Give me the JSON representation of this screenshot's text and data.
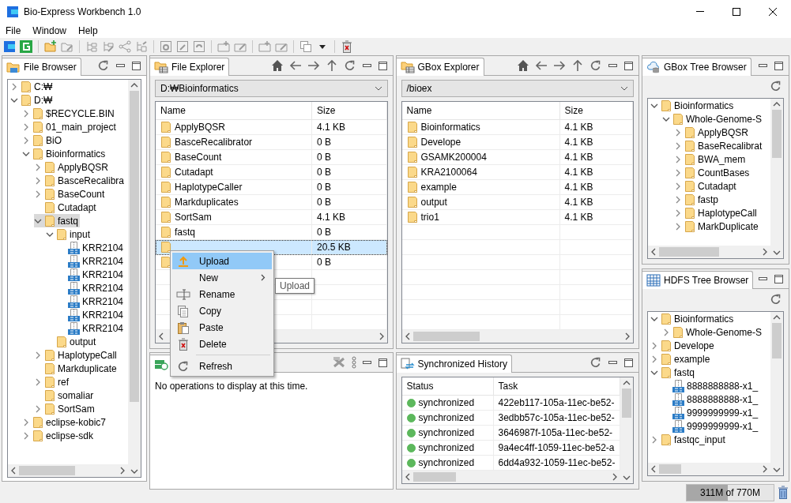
{
  "window": {
    "title": "Bio-Express Workbench 1.0"
  },
  "menu": [
    "File",
    "Window",
    "Help"
  ],
  "file_browser": {
    "title": "File Browser",
    "tree": [
      {
        "label": "C:₩",
        "kind": "folder",
        "expanded": false,
        "selected": false
      },
      {
        "label": "D:₩",
        "kind": "folder",
        "expanded": true,
        "selected": false,
        "children": [
          {
            "label": "$RECYCLE.BIN",
            "kind": "folder",
            "expanded": false,
            "selected": false
          },
          {
            "label": "01_main_project",
            "kind": "folder",
            "expanded": false,
            "selected": false
          },
          {
            "label": "BiO",
            "kind": "folder",
            "expanded": false,
            "selected": false
          },
          {
            "label": "Bioinformatics",
            "kind": "folder",
            "expanded": true,
            "selected": false,
            "children": [
              {
                "label": "ApplyBQSR",
                "kind": "folder",
                "expanded": false,
                "selected": false
              },
              {
                "label": "BasceRecalibra",
                "kind": "folder",
                "expanded": false,
                "selected": false
              },
              {
                "label": "BaseCount",
                "kind": "folder",
                "expanded": false,
                "selected": false
              },
              {
                "label": "Cutadapt",
                "kind": "folder",
                "selected": false
              },
              {
                "label": "fastq",
                "kind": "folder",
                "expanded": true,
                "selected": true,
                "children": [
                  {
                    "label": "input",
                    "kind": "folder",
                    "expanded": true,
                    "selected": false,
                    "children": [
                      {
                        "label": "KRR2104",
                        "kind": "archive",
                        "selected": false
                      },
                      {
                        "label": "KRR2104",
                        "kind": "archive",
                        "selected": false
                      },
                      {
                        "label": "KRR2104",
                        "kind": "archive",
                        "selected": false
                      },
                      {
                        "label": "KRR2104",
                        "kind": "archive",
                        "selected": false
                      },
                      {
                        "label": "KRR2104",
                        "kind": "archive",
                        "selected": false
                      },
                      {
                        "label": "KRR2104",
                        "kind": "archive",
                        "selected": false
                      },
                      {
                        "label": "KRR2104",
                        "kind": "archive",
                        "selected": false
                      }
                    ]
                  },
                  {
                    "label": "output",
                    "kind": "folder",
                    "selected": false
                  }
                ]
              },
              {
                "label": "HaplotypeCall",
                "kind": "folder",
                "expanded": false,
                "selected": false
              },
              {
                "label": "Markduplicate",
                "kind": "folder",
                "selected": false
              },
              {
                "label": "ref",
                "kind": "folder",
                "expanded": false,
                "selected": false
              },
              {
                "label": "somaliar",
                "kind": "folder",
                "selected": false
              },
              {
                "label": "SortSam",
                "kind": "folder",
                "expanded": false,
                "selected": false
              }
            ]
          },
          {
            "label": "eclipse-kobic7",
            "kind": "folder",
            "expanded": false,
            "selected": false
          },
          {
            "label": "eclipse-sdk",
            "kind": "folder",
            "expanded": false,
            "selected": false
          }
        ]
      }
    ]
  },
  "file_explorer": {
    "title": "File Explorer",
    "path": "D:₩Bioinformatics",
    "columns": [
      "Name",
      "Size"
    ],
    "rows": [
      {
        "name": "ApplyBQSR",
        "size": "4.1 KB",
        "selected": false
      },
      {
        "name": "BasceRecalibrator",
        "size": "0 B",
        "selected": false
      },
      {
        "name": "BaseCount",
        "size": "0 B",
        "selected": false
      },
      {
        "name": "Cutadapt",
        "size": "0 B",
        "selected": false
      },
      {
        "name": "HaplotypeCaller",
        "size": "0 B",
        "selected": false
      },
      {
        "name": "Markduplicates",
        "size": "0 B",
        "selected": false
      },
      {
        "name": "SortSam",
        "size": "4.1 KB",
        "selected": false
      },
      {
        "name": "fastq",
        "size": "0 B",
        "selected": false
      },
      {
        "size": "20.5 KB",
        "selected": true
      },
      {
        "size": "0 B",
        "selected": false
      }
    ]
  },
  "gbox_explorer": {
    "title": "GBox Explorer",
    "path": "/bioex",
    "columns": [
      "Name",
      "Size"
    ],
    "rows": [
      {
        "name": "Bioinformatics",
        "size": "4.1 KB",
        "selected": false
      },
      {
        "name": "Develope",
        "size": "4.1 KB",
        "selected": false
      },
      {
        "name": "GSAMK200004",
        "size": "4.1 KB",
        "selected": false
      },
      {
        "name": "KRA2100064",
        "size": "4.1 KB",
        "selected": false
      },
      {
        "name": "example",
        "size": "4.1 KB",
        "selected": false
      },
      {
        "name": "output",
        "size": "4.1 KB",
        "selected": false
      },
      {
        "name": "trio1",
        "size": "4.1 KB",
        "selected": false
      }
    ]
  },
  "context_menu": {
    "items": [
      {
        "kind": "item",
        "label": "Upload",
        "selected": true
      },
      {
        "kind": "submenu",
        "label": "New",
        "selected": false
      },
      {
        "kind": "item",
        "label": "Rename",
        "selected": false
      },
      {
        "kind": "item",
        "label": "Copy",
        "selected": false
      },
      {
        "kind": "item",
        "label": "Paste",
        "selected": false
      },
      {
        "kind": "item",
        "label": "Delete",
        "selected": false
      },
      {
        "kind": "separator"
      },
      {
        "kind": "item",
        "label": "Refresh",
        "selected": false
      }
    ],
    "tooltip": "Upload"
  },
  "operations": {
    "message": "No operations to display at this time."
  },
  "sync_history": {
    "title": "Synchronized History",
    "columns": [
      "Status",
      "Task"
    ],
    "rows": [
      {
        "status": "synchronized",
        "task": "422eb117-105a-11ec-be52-",
        "color": "#5cb85c"
      },
      {
        "status": "synchronized",
        "task": "3edbb57c-105a-11ec-be52-",
        "color": "#5cb85c"
      },
      {
        "status": "synchronized",
        "task": "3646987f-105a-11ec-be52-",
        "color": "#5cb85c"
      },
      {
        "status": "synchronized",
        "task": "9a4ec4ff-1059-11ec-be52-a",
        "color": "#5cb85c"
      },
      {
        "status": "synchronized",
        "task": "6dd4a932-1059-11ec-be52-",
        "color": "#5cb85c"
      }
    ]
  },
  "gbox_tree": {
    "title": "GBox Tree Browser",
    "tree": [
      {
        "label": "Bioinformatics",
        "kind": "folder",
        "expanded": true,
        "selected": false,
        "children": [
          {
            "label": "Whole-Genome-S",
            "kind": "folder",
            "expanded": true,
            "selected": false,
            "children": [
              {
                "label": "ApplyBQSR",
                "kind": "folder",
                "expanded": false,
                "selected": false
              },
              {
                "label": "BaseRecalibrat",
                "kind": "folder",
                "expanded": false,
                "selected": false
              },
              {
                "label": "BWA_mem",
                "kind": "folder",
                "expanded": false,
                "selected": false
              },
              {
                "label": "CountBases",
                "kind": "folder",
                "expanded": false,
                "selected": false
              },
              {
                "label": "Cutadapt",
                "kind": "folder",
                "expanded": false,
                "selected": false
              },
              {
                "label": "fastp",
                "kind": "folder",
                "expanded": false,
                "selected": false
              },
              {
                "label": "HaplotypeCall",
                "kind": "folder",
                "expanded": false,
                "selected": false
              },
              {
                "label": "MarkDuplicate",
                "kind": "folder",
                "expanded": false,
                "selected": false
              }
            ]
          }
        ]
      }
    ]
  },
  "hdfs_tree": {
    "title": "HDFS Tree Browser",
    "tree": [
      {
        "label": "Bioinformatics",
        "kind": "folder",
        "expanded": true,
        "selected": false,
        "children": [
          {
            "label": "Whole-Genome-S",
            "kind": "folder",
            "expanded": false,
            "selected": false
          }
        ]
      },
      {
        "label": "Develope",
        "kind": "folder",
        "expanded": false,
        "selected": false
      },
      {
        "label": "example",
        "kind": "folder",
        "expanded": false,
        "selected": false
      },
      {
        "label": "fastq",
        "kind": "folder",
        "expanded": true,
        "selected": false,
        "children": [
          {
            "label": "8888888888-x1_",
            "kind": "archive",
            "selected": false
          },
          {
            "label": "8888888888-x1_",
            "kind": "archive",
            "selected": false
          },
          {
            "label": "9999999999-x1_",
            "kind": "archive",
            "selected": false
          },
          {
            "label": "9999999999-x1_",
            "kind": "archive",
            "selected": false
          }
        ]
      },
      {
        "label": "fastqc_input",
        "kind": "folder",
        "expanded": false,
        "selected": false
      }
    ]
  },
  "status_bar": {
    "memory": "311M of 770M",
    "level": 0.47
  }
}
